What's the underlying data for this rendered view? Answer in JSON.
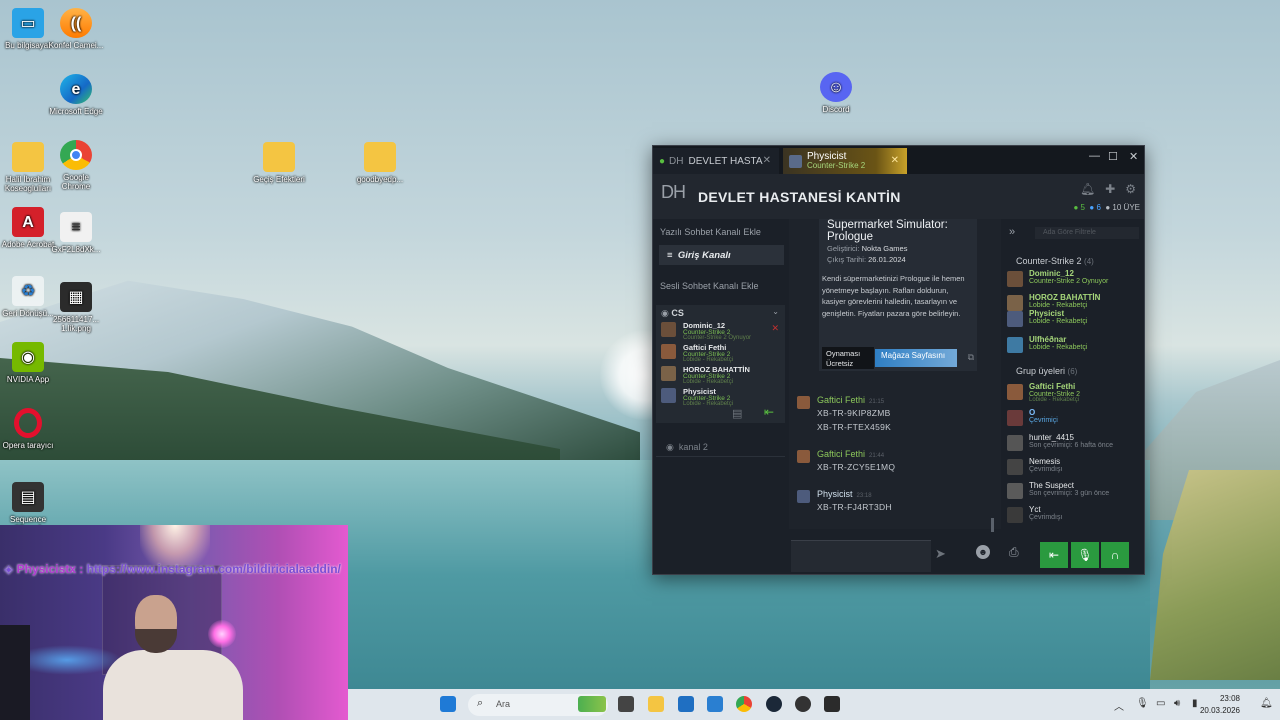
{
  "desktop": {
    "icons": [
      {
        "label": "Bu bilgisayar"
      },
      {
        "label": "Konfel Camei..."
      },
      {
        "label": "Microsoft Edge"
      },
      {
        "label": "Halil İbrahim Koseoglulları"
      },
      {
        "label": "Google Chrome"
      },
      {
        "label": "Geçiş Efektleri"
      },
      {
        "label": "goodbyedp..."
      },
      {
        "label": "Adobe Acrobat"
      },
      {
        "label": "GxF2L8dXk..."
      },
      {
        "label": "Geri Dönüşü..."
      },
      {
        "label": "256611417... 1.lik.png"
      },
      {
        "label": "NVIDIA App"
      },
      {
        "label": "Opera tarayıcı"
      },
      {
        "label": "Sequence 02.mp4"
      },
      {
        "label": "Discord"
      }
    ]
  },
  "steam": {
    "tabs": [
      {
        "label": "DEVLET HASTA",
        "prefix": "DH"
      },
      {
        "label": "Physicist",
        "sub": "Counter-Strike 2"
      }
    ],
    "header": {
      "logo": "DH",
      "title": "DEVLET HASTANESİ KANTİN",
      "online": "5",
      "in_voice": "6",
      "members": "10 ÜYE"
    },
    "left": {
      "text_channel_add": "Yazılı Sohbet Kanalı Ekle",
      "active_channel": "Giriş Kanalı",
      "voice_channel_add": "Sesli Sohbet Kanalı Ekle",
      "voice_channel_name": "CS",
      "voice_users": [
        {
          "name": "Dominic_12",
          "game": "Counter-Strike 2",
          "state": "Counter-Strike 2 Oynuyor"
        },
        {
          "name": "Gaftici Fethi",
          "game": "Counter-Strike 2",
          "state": "Lobide - Rekabetçi"
        },
        {
          "name": "HOROZ BAHATTİN",
          "game": "Counter-Strike 2",
          "state": "Lobide - Rekabetçi"
        },
        {
          "name": "Physicist",
          "game": "Counter-Strike 2",
          "state": "Lobide - Rekabetçi"
        }
      ],
      "channel2": "kanal 2"
    },
    "store_card": {
      "title": "Supermarket Simulator: Prologue",
      "developer_label": "Geliştirici:",
      "developer": "Nokta Games",
      "release_label": "Çıkış Tarihi:",
      "release": "26.01.2024",
      "description": "Kendi süpermarketinizi Prologue ile hemen yönetmeye başlayın. Rafları doldurun, kasiyer görevlerini halledin, tasarlayın ve genişletin. Fiyatları pazara göre belirleyin.",
      "free_label": "Oynaması Ücretsiz",
      "store_button": "Mağaza Sayfasını"
    },
    "messages": [
      {
        "author": "Gaftici Fethi",
        "time": "21:15",
        "lines": [
          "XB-TR-9KIP8ZMB",
          "XB-TR-FTEX459K"
        ]
      },
      {
        "author": "Gaftici Fethi",
        "time": "21:44",
        "lines": [
          "XB-TR-ZCY5E1MQ"
        ]
      },
      {
        "author": "Physicist",
        "time": "23:18",
        "lines": [
          "XB-TR-FJ4RT3DH"
        ]
      }
    ],
    "right": {
      "search_placeholder": "Ada Göre Filtrele",
      "game_group": "Counter-Strike 2",
      "game_group_count": "(4)",
      "game_members": [
        {
          "name": "Dominic_12",
          "status": "Counter-Strike 2 Oynuyor"
        },
        {
          "name": "HOROZ BAHATTİN",
          "status": "Lobide - Rekabetçi"
        },
        {
          "name": "Physicist",
          "status": "Lobide - Rekabetçi"
        },
        {
          "name": "Ulfhéðnar",
          "status": "Lobide - Rekabetçi"
        }
      ],
      "group_label": "Grup üyeleri",
      "group_count": "(6)",
      "group_members": [
        {
          "name": "Gaftici Fethi",
          "status": "Counter-Strike 2",
          "status2": "Lobide - Rekabetçi"
        },
        {
          "name": "O",
          "status": "Çevrimiçi"
        },
        {
          "name": "hunter_4415",
          "status": "Son çevrimiçi: 6 hafta önce"
        },
        {
          "name": "Nemesis",
          "status": "Çevrimdışı"
        },
        {
          "name": "The Suspect",
          "status": "Son çevrimiçi: 3 gün önce"
        },
        {
          "name": "Yct",
          "status": "Çevrimdışı"
        }
      ]
    }
  },
  "overlay": {
    "insta_user": "Physicistx :",
    "insta_link": "https://www.instagram.com/bildiricialaaddin/"
  },
  "taskbar": {
    "search_label": "Ara",
    "time": "23:08",
    "date": "20.03.2026"
  },
  "colors": {
    "steam_bg": "#1b2028",
    "accent_green": "#2a9a3f",
    "friend_green": "#8cc75b",
    "store_blue": "#2f7fc4"
  }
}
